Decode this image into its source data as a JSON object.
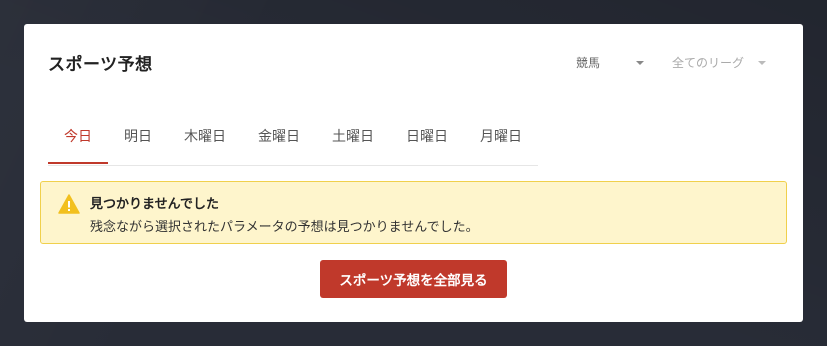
{
  "card": {
    "title": "スポーツ予想",
    "filters": {
      "sport": "競馬",
      "league": "全てのリーグ"
    }
  },
  "tabs": [
    {
      "label": "今日",
      "active": true
    },
    {
      "label": "明日",
      "active": false
    },
    {
      "label": "木曜日",
      "active": false
    },
    {
      "label": "金曜日",
      "active": false
    },
    {
      "label": "土曜日",
      "active": false
    },
    {
      "label": "日曜日",
      "active": false
    },
    {
      "label": "月曜日",
      "active": false
    }
  ],
  "alert": {
    "icon": "warning-icon",
    "title": "見つかりませんでした",
    "text": "残念ながら選択されたパラメータの予想は見つかりませんでした。"
  },
  "cta": {
    "label": "スポーツ予想を全部見る"
  },
  "colors": {
    "accent": "#c0392b",
    "alert_bg": "#fef5cc",
    "alert_border": "#f0d04c",
    "warning_icon": "#f2c01e",
    "page_bg": "#282c37"
  }
}
